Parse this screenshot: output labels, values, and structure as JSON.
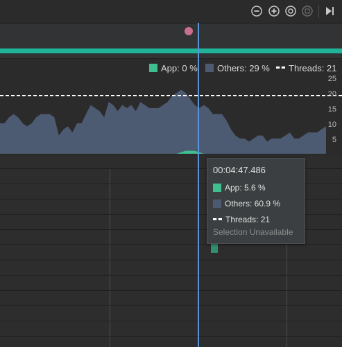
{
  "toolbar": {
    "buttons": [
      {
        "name": "zoom-out",
        "icon": "minus-circle-icon"
      },
      {
        "name": "zoom-in",
        "icon": "plus-circle-icon"
      },
      {
        "name": "reset-zoom",
        "icon": "reset-circle-icon"
      },
      {
        "name": "attach",
        "icon": "attach-icon"
      },
      {
        "name": "go-live",
        "icon": "skip-to-end-icon"
      }
    ]
  },
  "colors": {
    "app": "#3fbe8f",
    "others": "#4c5a72",
    "threads": "#ffffff",
    "state_bar": "#1fb39a",
    "event_dot": "#c86f8e",
    "cursor": "#5b93d8"
  },
  "legend": {
    "app": "App: 0 %",
    "others": "Others: 29 %",
    "threads": "Threads: 21"
  },
  "chart_data": {
    "type": "area",
    "y_ticks": [
      "25",
      "20",
      "15",
      "10",
      "5"
    ],
    "series": [
      {
        "name": "Others",
        "values": [
          10,
          10,
          12,
          13,
          12,
          10,
          9,
          10,
          12,
          13,
          13,
          13,
          12,
          6,
          8,
          9,
          7,
          10,
          10,
          13,
          16,
          15,
          14,
          12,
          17,
          16,
          14,
          16,
          15,
          16,
          14,
          17,
          16,
          15,
          15,
          15,
          16,
          17,
          19,
          20,
          21,
          20,
          18,
          16,
          15,
          16,
          15,
          13,
          13,
          13,
          11,
          8,
          6,
          5,
          5,
          4,
          5,
          6,
          6,
          4,
          5,
          5,
          5,
          6,
          7,
          5,
          5,
          6,
          7,
          7,
          7,
          8,
          9
        ]
      },
      {
        "name": "App",
        "values": [
          0,
          0,
          0,
          0,
          0,
          0,
          0,
          0,
          0,
          0,
          0,
          0,
          0,
          0,
          0,
          0,
          0,
          0,
          0,
          0,
          0,
          0,
          0,
          0,
          0,
          0,
          0,
          0,
          0,
          0,
          0,
          0,
          0,
          0,
          0,
          0,
          0,
          0,
          0,
          0,
          0.5,
          1,
          1,
          1,
          0.5,
          0,
          0,
          0,
          0,
          0,
          0,
          0,
          0,
          0,
          0,
          0,
          0,
          0,
          0,
          0,
          0,
          0,
          0,
          0,
          0,
          0,
          0,
          0,
          0,
          0,
          0,
          0,
          0
        ]
      },
      {
        "name": "Threads",
        "values": [
          21,
          21,
          21,
          21,
          21,
          21,
          21,
          21,
          21,
          21,
          21,
          21,
          21,
          21,
          21,
          21,
          21,
          21,
          21,
          21,
          21,
          21,
          21,
          21,
          21,
          21,
          21,
          21,
          21,
          21,
          21,
          21,
          21,
          21,
          21,
          21,
          21,
          21,
          21,
          21,
          21,
          21,
          21,
          21,
          21,
          21,
          21,
          21,
          21,
          21,
          21,
          21,
          21,
          21,
          21,
          21,
          21,
          21,
          21,
          21,
          21,
          21,
          21,
          21,
          21,
          21,
          21,
          21,
          21,
          21,
          21,
          21,
          21
        ]
      }
    ]
  },
  "tooltip": {
    "time": "00:04:47.486",
    "app": "App: 5.6 %",
    "others": "Others: 60.9 %",
    "threads": "Threads: 21",
    "footer": "Selection Unavailable"
  }
}
